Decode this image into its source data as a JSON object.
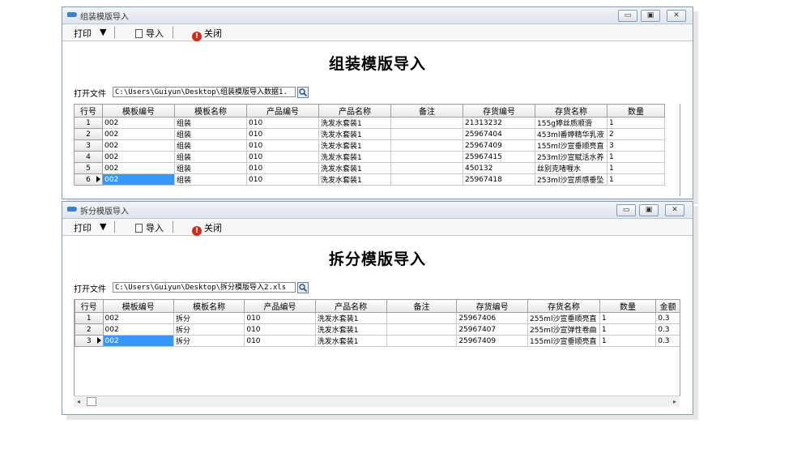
{
  "window1": {
    "title": "组装模版导入",
    "toolbar": {
      "print": "打印",
      "print_arrow": "▼",
      "import": "导入",
      "close": "关闭"
    },
    "heading": "组装模版导入",
    "file_label": "打开文件",
    "file_path": "C:\\Users\\Guiyun\\Desktop\\组装模版导入数据1.",
    "columns": [
      "行号",
      "模板编号",
      "模板名称",
      "产品编号",
      "产品名称",
      "备注",
      "存货编号",
      "存货名称",
      "数量"
    ],
    "rows": [
      [
        "1",
        "002",
        "组装",
        "010",
        "洗发水套装1",
        "",
        "21313232",
        "155g婷丝质顺滑",
        "1"
      ],
      [
        "2",
        "002",
        "组装",
        "010",
        "洗发水套装1",
        "",
        "25967404",
        "453ml番婷精华乳液",
        "2"
      ],
      [
        "3",
        "002",
        "组装",
        "010",
        "洗发水套装1",
        "",
        "25967409",
        "155ml沙宣垂顺亮直",
        "3"
      ],
      [
        "4",
        "002",
        "组装",
        "010",
        "洗发水套装1",
        "",
        "25967415",
        "253ml沙宣赋活水养",
        "1"
      ],
      [
        "5",
        "002",
        "组装",
        "010",
        "洗发水套装1",
        "",
        "450132",
        "丝别克啫喱水",
        "1"
      ],
      [
        "6",
        "002",
        "组装",
        "010",
        "洗发水套装1",
        "",
        "25967418",
        "253ml沙宣质感垂坠",
        "1"
      ]
    ]
  },
  "window2": {
    "title": "拆分模版导入",
    "toolbar": {
      "print": "打印",
      "print_arrow": "▼",
      "import": "导入",
      "close": "关闭"
    },
    "heading": "拆分模版导入",
    "file_label": "打开文件",
    "file_path": "C:\\Users\\Guiyun\\Desktop\\拆分模版导入2.xls",
    "columns": [
      "行号",
      "模板编号",
      "模板名称",
      "产品编号",
      "产品名称",
      "备注",
      "存货编号",
      "存货名称",
      "数量",
      "金额"
    ],
    "rows": [
      [
        "1",
        "002",
        "拆分",
        "010",
        "洗发水套装1",
        "",
        "25967406",
        "255ml沙宣垂顺亮直",
        "1",
        "0.3"
      ],
      [
        "2",
        "002",
        "拆分",
        "010",
        "洗发水套装1",
        "",
        "25967407",
        "255ml沙宣弹性卷曲",
        "1",
        "0.3"
      ],
      [
        "3",
        "002",
        "拆分",
        "010",
        "洗发水套装1",
        "",
        "25967409",
        "155ml沙宣垂顺亮直",
        "1",
        "0.3"
      ]
    ]
  },
  "window_buttons": {
    "minimize": "▭",
    "maximize": "▣",
    "close": "✕"
  },
  "colors": {
    "selection": "#3399ff",
    "title_icon": "#3d7fd0",
    "stop_icon": "#d42a1e"
  }
}
